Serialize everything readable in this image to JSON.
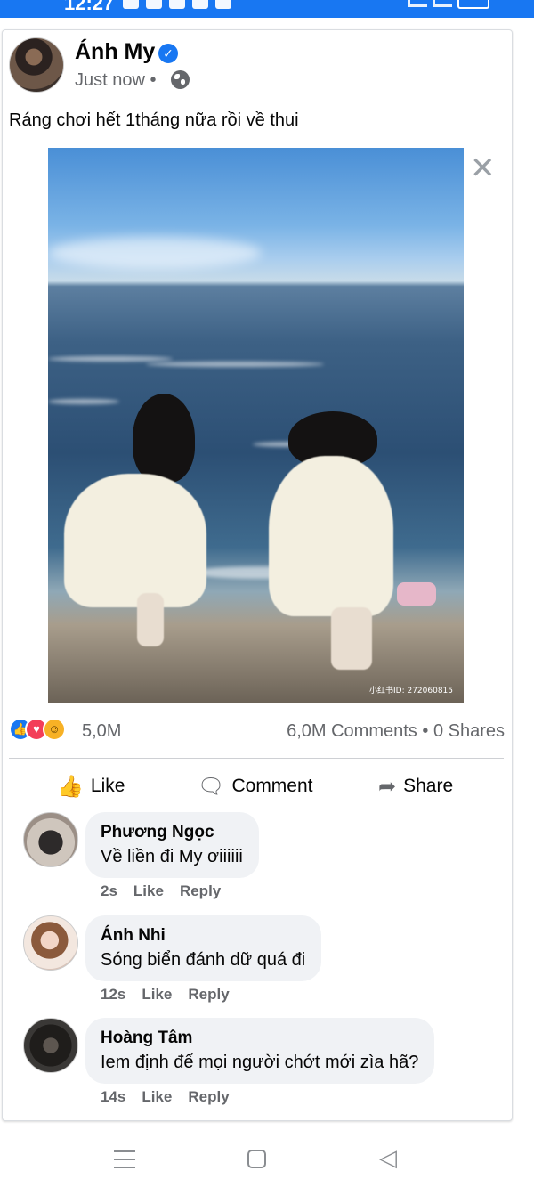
{
  "status_bar": {
    "time": "12:27"
  },
  "post": {
    "author": "Ánh My",
    "time": "Just now",
    "text": "Ráng chơi hết 1tháng nữa rồi về thui",
    "image_watermark": "小红书ID: 272060815",
    "reaction_count": "5,0M",
    "comments_count": "6,0M Comments",
    "separator": "•",
    "shares_count": "0 Shares"
  },
  "actions": {
    "like": "Like",
    "comment": "Comment",
    "share": "Share"
  },
  "comments": [
    {
      "name": "Phương Ngọc",
      "text": "Về liền đi My ơiiiiii",
      "time": "2s",
      "like": "Like",
      "reply": "Reply"
    },
    {
      "name": "Ánh Nhi",
      "text": "Sóng biển đánh dữ quá đi",
      "time": "12s",
      "like": "Like",
      "reply": "Reply"
    },
    {
      "name": "Hoàng Tâm",
      "text": "Iem định để mọi người chớt mới zìa hã?",
      "time": "14s",
      "like": "Like",
      "reply": "Reply"
    }
  ],
  "colors": {
    "brand": "#1877f2",
    "text": "#050505",
    "secondary": "#65676b",
    "bubble": "#f0f2f5"
  },
  "icons": [
    "globe-icon",
    "verified-badge-icon",
    "close-icon",
    "like-reaction-icon",
    "love-reaction-icon",
    "haha-reaction-icon",
    "thumbs-up-icon",
    "comment-icon",
    "share-arrow-icon",
    "menu-icon",
    "home-square-icon",
    "back-triangle-icon"
  ]
}
